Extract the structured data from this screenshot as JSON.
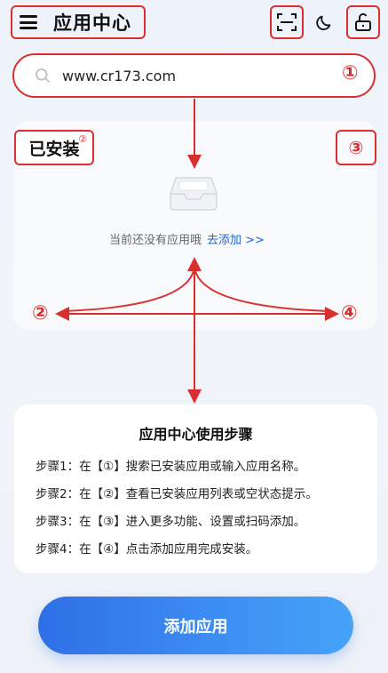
{
  "header": {
    "title": "应用中心",
    "menu_icon": "hamburger-menu-icon",
    "scan_icon": "scan-icon",
    "moon_icon": "moon-icon",
    "lock_icon": "unlock-icon"
  },
  "search": {
    "value": "www.cr173.com",
    "marker": "①"
  },
  "installed": {
    "label": "已安装",
    "superscript": "②",
    "right_marker": "③",
    "empty_text": "当前还没有应用哦",
    "add_link": "去添加 >>"
  },
  "markers": {
    "left": "②",
    "right": "④"
  },
  "steps": {
    "title": "应用中心使用步骤",
    "lines": [
      "步骤1：在【①】搜索已安装应用或输入应用名称。",
      "步骤2：在【②】查看已安装应用列表或空状态提示。",
      "步骤3：在【③】进入更多功能、设置或扫码添加。",
      "步骤4：在【④】点击添加应用完成安装。"
    ]
  },
  "bottom_button": {
    "label": "添加应用"
  },
  "colors": {
    "annotation_red": "#d9302f",
    "button_blue": "#2f6fe6",
    "link_blue": "#1a66d6"
  }
}
